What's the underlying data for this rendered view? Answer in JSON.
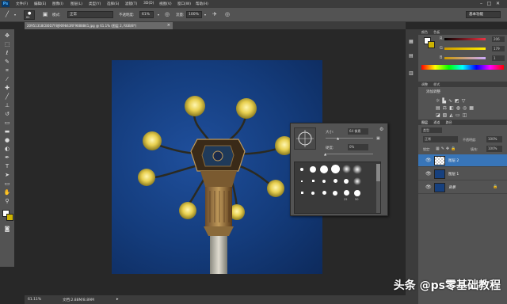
{
  "menubar": {
    "logo": "Ps",
    "items": [
      "文件(F)",
      "编辑(E)",
      "图像(I)",
      "图层(L)",
      "类型(Y)",
      "选择(S)",
      "滤镜(T)",
      "3D(D)",
      "视图(V)",
      "窗口(W)",
      "帮助(H)"
    ],
    "minimize": "–",
    "maximize": "□",
    "close": "✕"
  },
  "options": {
    "brush_size": "64",
    "mode_label": "模式:",
    "mode_value": "正常",
    "opacity_label": "不透明度:",
    "opacity_value": "61%",
    "flow_label": "流量:",
    "flow_value": "100%",
    "workspace": "基本功能"
  },
  "document": {
    "tab_title": "20951318CB0D7F8J909843RF9088841.jpg @ 61.1% (图层 2, RGB/8*)",
    "tab_close": "×",
    "zoom": "61.11%",
    "doc_size": "文档:2.88M/8.89M"
  },
  "brush_popup": {
    "size_label": "大小:",
    "size_value": "64 像素",
    "hardness_label": "硬度:",
    "hardness_value": "0%",
    "presets_row3": [
      "25",
      "50"
    ]
  },
  "color_panel": {
    "tabs": [
      "颜色",
      "色板"
    ],
    "channels": [
      {
        "name": "R",
        "value": "206",
        "color": "#e34"
      },
      {
        "name": "G",
        "value": "179",
        "color": "#3c3"
      },
      {
        "name": "B",
        "value": "1",
        "color": "#36f"
      }
    ],
    "fg_color": "#cdb301",
    "bg_color": "#ffffff"
  },
  "adjustments_panel": {
    "tabs": [
      "调整",
      "样式"
    ],
    "title": "添加调整"
  },
  "layers_panel": {
    "tabs": [
      "图层",
      "通道",
      "路径"
    ],
    "kind_label": "类型",
    "blend_mode": "正常",
    "opacity_label": "不透明度:",
    "opacity_value": "100%",
    "lock_label": "锁定:",
    "fill_label": "填充:",
    "fill_value": "100%",
    "layers": [
      {
        "name": "图层 2",
        "selected": true
      },
      {
        "name": "图层 1",
        "selected": false
      },
      {
        "name": "背景",
        "selected": false
      }
    ]
  },
  "watermark": "头条 @ps零基础教程",
  "accent": "#3875b8"
}
